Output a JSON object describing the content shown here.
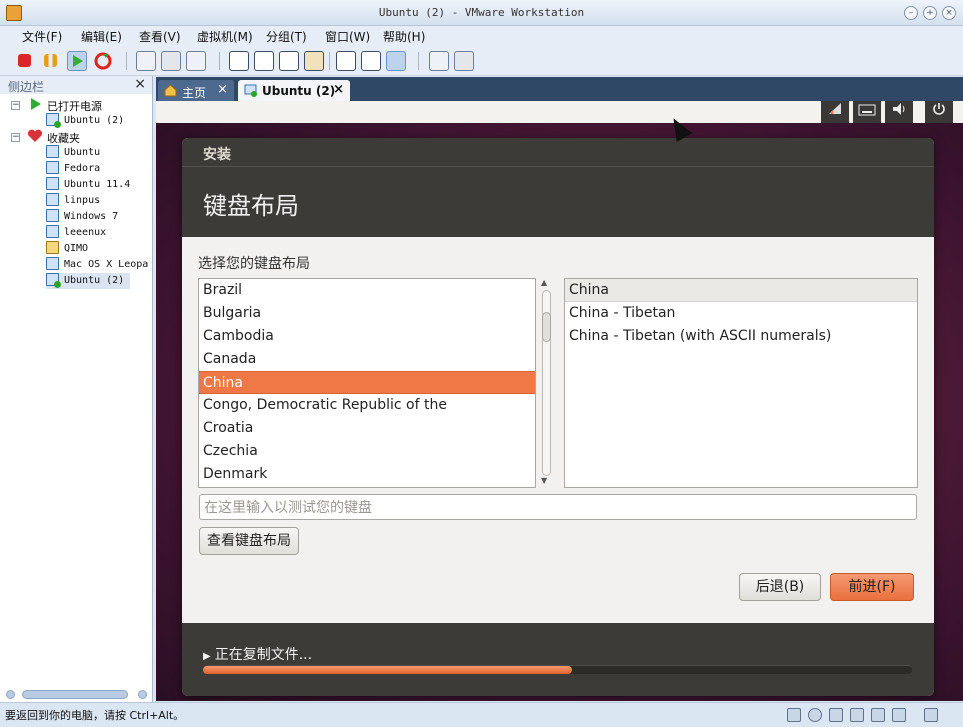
{
  "window": {
    "title": "Ubuntu (2) - VMware Workstation"
  },
  "menu": [
    "文件(F)",
    "编辑(E)",
    "查看(V)",
    "虚拟机(M)",
    "分组(T)",
    "窗口(W)",
    "帮助(H)"
  ],
  "sidebar": {
    "label": "侧边栏",
    "close": "×",
    "groups": [
      {
        "label": "已打开电源",
        "items": [
          "Ubuntu (2)"
        ]
      },
      {
        "label": "收藏夹",
        "items": [
          "Ubuntu",
          "Fedora",
          "Ubuntu 11.4",
          "linpus",
          "Windows 7",
          "leeenux",
          "QIMO",
          "Mac OS X Leopa",
          "Ubuntu (2)"
        ]
      }
    ]
  },
  "tabs": [
    {
      "label": "主页",
      "close": "×"
    },
    {
      "label": "Ubuntu (2)",
      "close": "×"
    }
  ],
  "installer": {
    "window_title": "安装",
    "heading": "键盘布局",
    "prompt": "选择您的键盘布局",
    "layouts": [
      "Brazil",
      "Bulgaria",
      "Cambodia",
      "Canada",
      "China",
      "Congo, Democratic Republic of the",
      "Croatia",
      "Czechia",
      "Denmark"
    ],
    "selected_layout": "China",
    "variants": [
      "China",
      "China - Tibetan",
      "China - Tibetan (with ASCII numerals)"
    ],
    "selected_variant": "China",
    "test_placeholder": "在这里输入以测试您的键盘",
    "detect_button": "查看键盘布局",
    "back_button": "后退(B)",
    "forward_button": "前进(F)",
    "footer_text": "正在复制文件...",
    "progress": 0.52
  },
  "statusbar": {
    "message": "要返回到你的电脑，请按 Ctrl+Alt。"
  },
  "colors": {
    "accent": "#f07746",
    "dark": "#3c3b37",
    "tab_bar": "#2f4866"
  }
}
